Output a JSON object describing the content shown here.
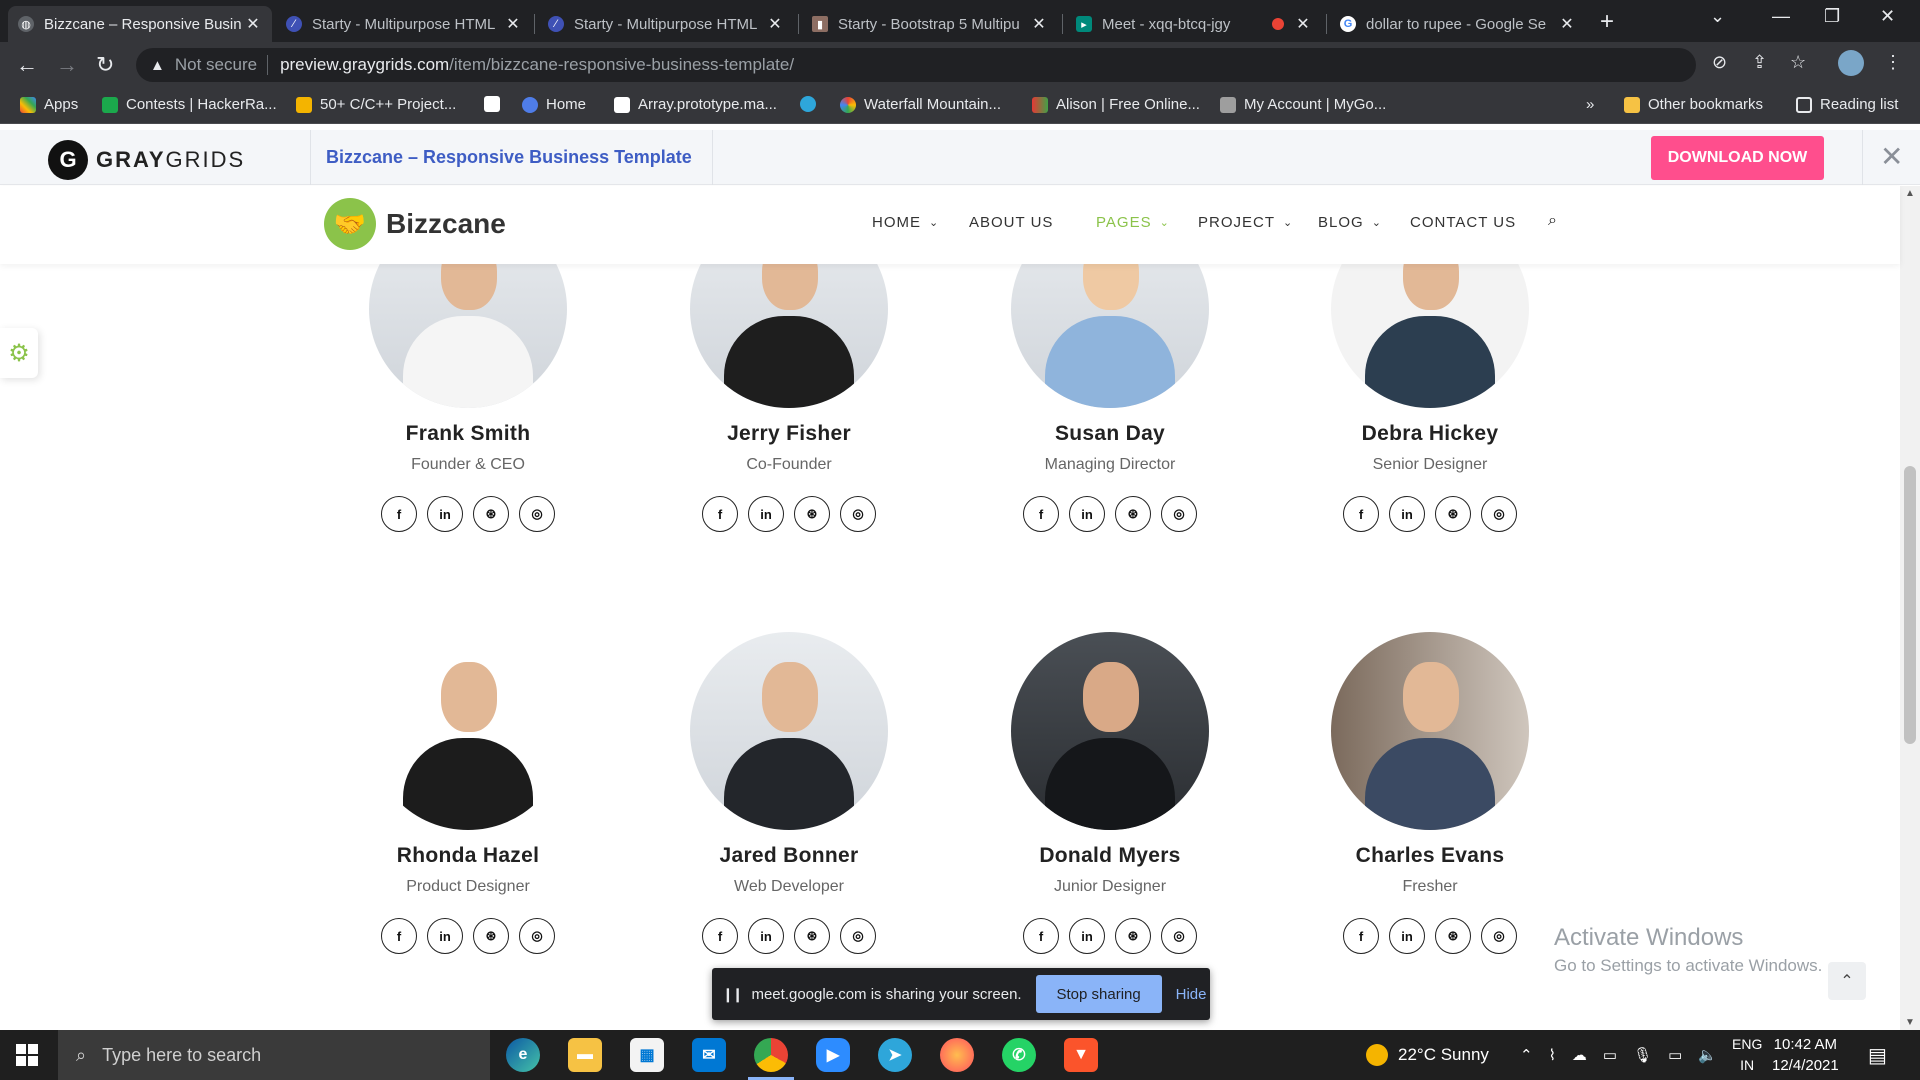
{
  "browser": {
    "tabs": [
      {
        "title": "Bizzcane – Responsive Busin",
        "active": true
      },
      {
        "title": "Starty - Multipurpose HTML"
      },
      {
        "title": "Starty - Multipurpose HTML"
      },
      {
        "title": "Starty - Bootstrap 5 Multipu"
      },
      {
        "title": "Meet - xqq-btcq-jgy"
      },
      {
        "title": "dollar to rupee - Google Se"
      }
    ],
    "address": {
      "security": "Not secure",
      "host": "preview.graygrids.com",
      "path": "/item/bizzcane-responsive-business-template/"
    },
    "bookmarks": {
      "apps": "Apps",
      "items": [
        "Contests | HackerRa...",
        "50+ C/C++ Project...",
        "Home",
        "Array.prototype.ma...",
        "Waterfall Mountain...",
        "Alison | Free Online...",
        "My Account | MyGo..."
      ],
      "more": "»",
      "other": "Other bookmarks",
      "reading": "Reading list"
    }
  },
  "preview_bar": {
    "logo_letter": "G",
    "logo_bold": "GRAY",
    "logo_light": "GRIDS",
    "title": "Bizzcane – Responsive Business Template",
    "download_label": "DOWNLOAD NOW"
  },
  "site": {
    "brand": "Bizzcane",
    "nav": [
      {
        "label": "HOME",
        "caret": true
      },
      {
        "label": "ABOUT US",
        "caret": false
      },
      {
        "label": "PAGES",
        "caret": true,
        "active": true
      },
      {
        "label": "PROJECT",
        "caret": true
      },
      {
        "label": "BLOG",
        "caret": true
      },
      {
        "label": "CONTACT US",
        "caret": false
      }
    ],
    "accent": "#8bc34a"
  },
  "team": [
    {
      "name": "Frank Smith",
      "role": "Founder & CEO"
    },
    {
      "name": "Jerry Fisher",
      "role": "Co-Founder"
    },
    {
      "name": "Susan Day",
      "role": "Managing Director"
    },
    {
      "name": "Debra Hickey",
      "role": "Senior Designer"
    },
    {
      "name": "Rhonda Hazel",
      "role": "Product Designer"
    },
    {
      "name": "Jared Bonner",
      "role": "Web Developer"
    },
    {
      "name": "Donald Myers",
      "role": "Junior Designer"
    },
    {
      "name": "Charles Evans",
      "role": "Fresher"
    }
  ],
  "social_icons": [
    "f",
    "in",
    "⊛",
    "◎"
  ],
  "watermark": {
    "line1": "Activate Windows",
    "line2": "Go to Settings to activate Windows."
  },
  "share_bar": {
    "message": "meet.google.com is sharing your screen.",
    "stop_label": "Stop sharing",
    "hide_label": "Hide"
  },
  "taskbar": {
    "search_placeholder": "Type here to search",
    "weather": "22°C  Sunny",
    "lang_line1": "ENG",
    "lang_line2": "IN",
    "time": "10:42 AM",
    "date": "12/4/2021"
  }
}
